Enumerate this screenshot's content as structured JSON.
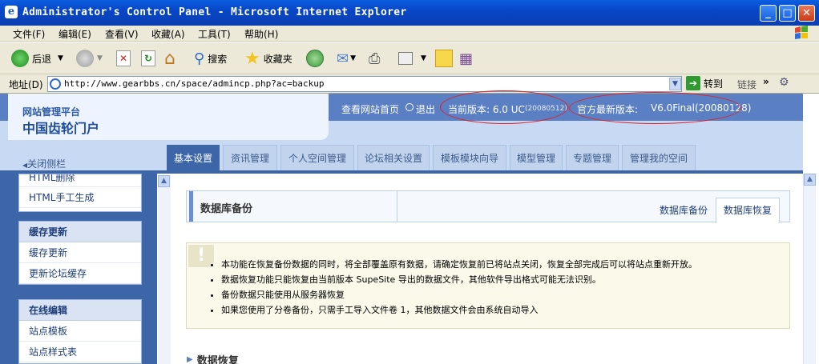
{
  "window": {
    "title": "Administrator's Control Panel - Microsoft Internet Explorer"
  },
  "menu": [
    "文件(F)",
    "编辑(E)",
    "查看(V)",
    "收藏(A)",
    "工具(T)",
    "帮助(H)"
  ],
  "toolbar": {
    "back": "后退",
    "search": "搜索",
    "favorites": "收藏夹"
  },
  "address": {
    "label": "地址(D)",
    "url": "http://www.gearbbs.cn/space/admincp.php?ac=backup",
    "go": "转到",
    "links": "链接"
  },
  "brand": {
    "platform": "网站管理平台",
    "site": "中国齿轮门户"
  },
  "header": {
    "home_link": "查看网站首页",
    "logout": "退出",
    "current_version_label": "当前版本: 6.0 UC",
    "current_version_build": "(20080512)",
    "latest_version_label": "官方最新版本:",
    "latest_version": "V6.0Final(20080128)"
  },
  "close_sidebar": "关闭侧栏",
  "tabs": [
    "基本设置",
    "资讯管理",
    "个人空间管理",
    "论坛相关设置",
    "模板模块向导",
    "模型管理",
    "专题管理",
    "管理我的空间"
  ],
  "sidebar": {
    "box1": {
      "items": [
        "HTML删除",
        "HTML手工生成"
      ]
    },
    "box2": {
      "title": "缓存更新",
      "items": [
        "缓存更新",
        "更新论坛缓存"
      ]
    },
    "box3": {
      "title": "在线编辑",
      "items": [
        "站点模板",
        "站点样式表"
      ]
    }
  },
  "content": {
    "title": "数据库备份",
    "tab_backup": "数据库备份",
    "tab_restore": "数据库恢复",
    "notices": [
      "本功能在恢复备份数据的同时，将全部覆盖原有数据，请确定恢复前已将站点关闭，恢复全部完成后可以将站点重新开放。",
      "数据恢复功能只能恢复由当前版本 SupeSite 导出的数据文件，其他软件导出格式可能无法识别。",
      "备份数据只能使用从服务器恢复",
      "如果您使用了分卷备份，只需手工导入文件卷 1，其他数据文件会由系统自动导入"
    ],
    "section": "数据恢复"
  }
}
